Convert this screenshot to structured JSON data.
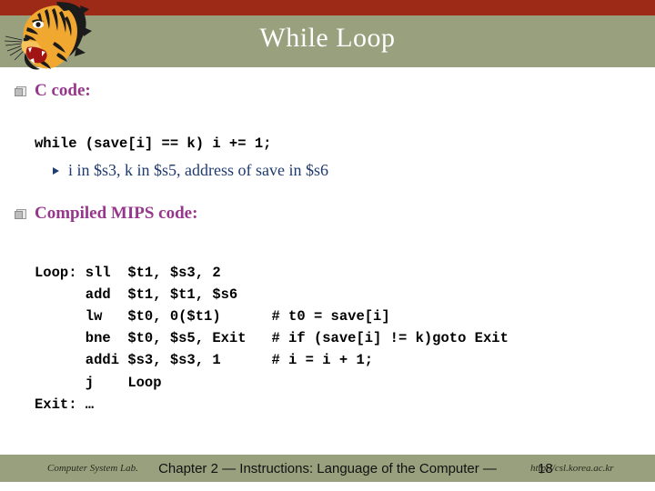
{
  "header": {
    "title": "While Loop",
    "logo_icon": "tiger-head-logo",
    "red_bar_color": "#9c2a16",
    "green_bar_color": "#99a07e",
    "title_color": "#ffffff"
  },
  "content": {
    "heading_color": "#97378c",
    "subbullet_color": "#1f3a6e",
    "sections": [
      {
        "bullet_icon": "square-bullet",
        "heading": "C code:",
        "code": "while (save[i] == k) i += 1;",
        "subbullets": [
          {
            "bullet_icon": "triangle-bullet",
            "text": "i in $s3, k in $s5, address of save in $s6"
          }
        ]
      },
      {
        "bullet_icon": "square-bullet",
        "heading": "Compiled MIPS code:",
        "code": "Loop: sll  $t1, $s3, 2\n      add  $t1, $t1, $s6\n      lw   $t0, 0($t1)      # t0 = save[i]\n      bne  $t0, $s5, Exit   # if (save[i] != k)goto Exit\n      addi $s3, $s3, 1      # i = i + 1;\n      j    Loop\nExit: …"
      }
    ]
  },
  "footer": {
    "band_color": "#99a07e",
    "lab_label": "Computer System Lab.",
    "url": "http://csl.korea.ac.kr",
    "chapter_text": "Chapter 2 — Instructions: Language of the Computer — ",
    "page_number": "18"
  }
}
